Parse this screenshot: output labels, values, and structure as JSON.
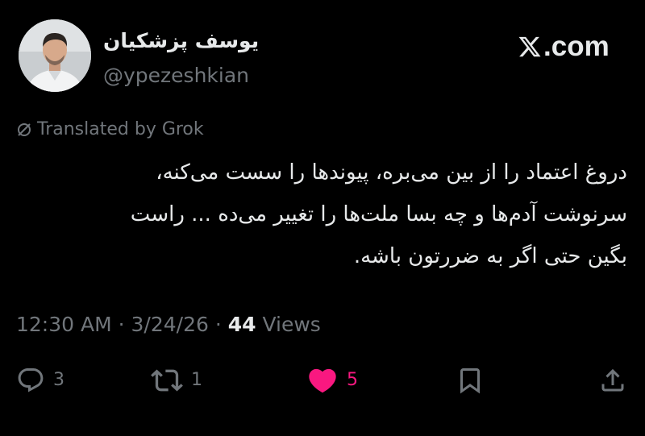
{
  "author": {
    "display_name": "یوسف پزشکیان",
    "handle": "@ypezeshkian",
    "avatar_icon": "profile-photo"
  },
  "brand": {
    "logo_icon": "x-logo-icon",
    "logo_text": ".com"
  },
  "translation": {
    "label": "Translated by Grok",
    "icon": "no-translate-icon"
  },
  "tweet": {
    "text": "دروغ اعتماد را از بین می‌بره، پیوندها را سست می‌کنه،\nسرنوشت آدم‌ها و چه بسا ملت‌ها را تغییر می‌ده ... راست\nبگین حتی اگر به ضررتون باشه."
  },
  "meta": {
    "time": "12:30 AM",
    "separator": " · ",
    "date": "3/24/26",
    "views_count": "44",
    "views_label": " Views"
  },
  "actions": {
    "reply": {
      "icon": "reply-icon",
      "count": "3"
    },
    "retweet": {
      "icon": "retweet-icon",
      "count": "1"
    },
    "like": {
      "icon": "heart-icon",
      "count": "5",
      "color": "#f91880"
    },
    "bookmark": {
      "icon": "bookmark-icon"
    },
    "share": {
      "icon": "share-icon"
    }
  },
  "colors": {
    "background": "#000000",
    "text": "#e7e9ea",
    "muted": "#71767b",
    "like": "#f91880"
  }
}
